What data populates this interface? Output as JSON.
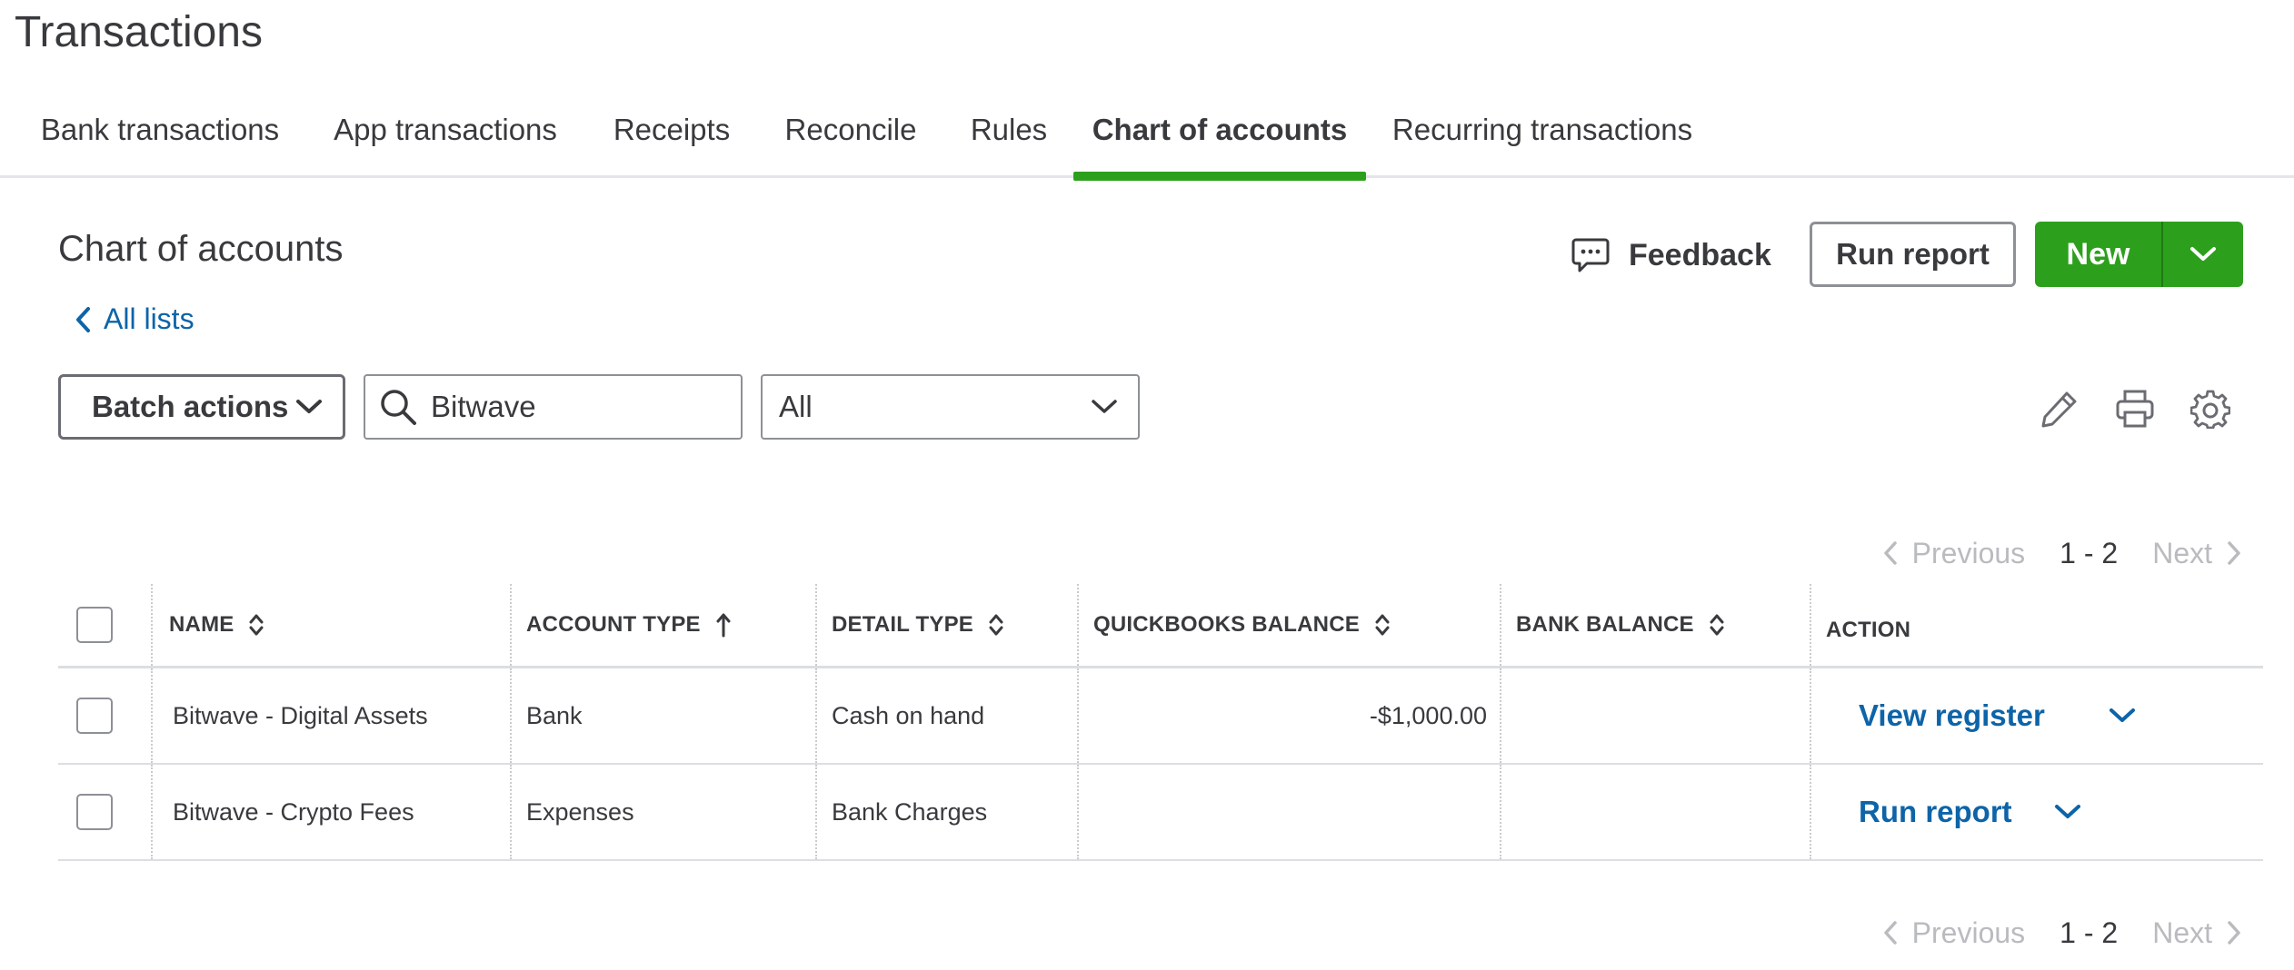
{
  "page": {
    "title": "Transactions"
  },
  "tabs": [
    {
      "label": "Bank transactions",
      "active": false
    },
    {
      "label": "App transactions",
      "active": false
    },
    {
      "label": "Receipts",
      "active": false
    },
    {
      "label": "Reconcile",
      "active": false
    },
    {
      "label": "Rules",
      "active": false
    },
    {
      "label": "Chart of accounts",
      "active": true
    },
    {
      "label": "Recurring transactions",
      "active": false
    }
  ],
  "section": {
    "title": "Chart of accounts",
    "back_link": "All lists",
    "feedback_label": "Feedback",
    "run_report_label": "Run report",
    "new_label": "New"
  },
  "toolbar": {
    "batch_actions_label": "Batch actions",
    "search_value": "Bitwave",
    "filter_value": "All"
  },
  "pagination": {
    "previous_label": "Previous",
    "range": "1 - 2",
    "next_label": "Next"
  },
  "table": {
    "columns": [
      "NAME",
      "ACCOUNT TYPE",
      "DETAIL TYPE",
      "QUICKBOOKS BALANCE",
      "BANK BALANCE",
      "ACTION"
    ],
    "rows": [
      {
        "name": "Bitwave - Digital Assets",
        "account_type": "Bank",
        "detail_type": "Cash on hand",
        "quickbooks_balance": "-$1,000.00",
        "bank_balance": "",
        "action": "View register"
      },
      {
        "name": "Bitwave - Crypto Fees",
        "account_type": "Expenses",
        "detail_type": "Bank Charges",
        "quickbooks_balance": "",
        "bank_balance": "",
        "action": "Run report"
      }
    ]
  },
  "colors": {
    "accent_green": "#2ca01c",
    "link_blue": "#0d64a8",
    "text_dark": "#393a3d",
    "disabled_gray": "#b9bbbf"
  },
  "icons": [
    "chevron-left-icon",
    "chat-bubble-icon",
    "chevron-down-icon",
    "search-icon",
    "pencil-icon",
    "printer-icon",
    "gear-icon",
    "sort-updown-icon",
    "arrow-up-icon",
    "chevron-right-icon"
  ]
}
